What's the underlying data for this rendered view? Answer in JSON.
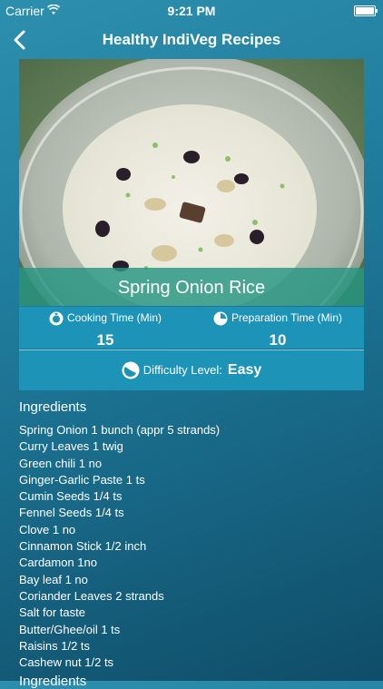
{
  "status_bar": {
    "carrier": "Carrier",
    "time": "9:21 PM"
  },
  "nav": {
    "title": "Healthy IndiVeg Recipes",
    "back_icon": "chevron-left-icon"
  },
  "recipe": {
    "name": "Spring Onion Rice",
    "cooking_time_label": "Cooking Time (Min)",
    "cooking_time_value": "15",
    "prep_time_label": "Preparation Time (Min)",
    "prep_time_value": "10",
    "difficulty_label": "Difficulty Level:",
    "difficulty_value": "Easy"
  },
  "ingredients": {
    "heading": "Ingredients",
    "items": [
      "Spring Onion 1 bunch (appr 5 strands)",
      "Curry Leaves 1 twig",
      "Green chili 1 no",
      "Ginger-Garlic Paste 1 ts",
      "Cumin Seeds 1/4 ts",
      "Fennel Seeds 1/4 ts",
      "Clove 1 no",
      "Cinnamon Stick 1/2 inch",
      "Cardamon 1no",
      "Bay leaf  1 no",
      "Coriander Leaves  2 strands",
      "Salt for taste",
      "Butter/Ghee/oil 1 ts",
      "Raisins 1/2 ts",
      "Cashew nut 1/2 ts"
    ]
  },
  "next_section_heading": "Ingredients",
  "colors": {
    "panel": "#1d93b8",
    "caption_overlay": "#26967f"
  }
}
